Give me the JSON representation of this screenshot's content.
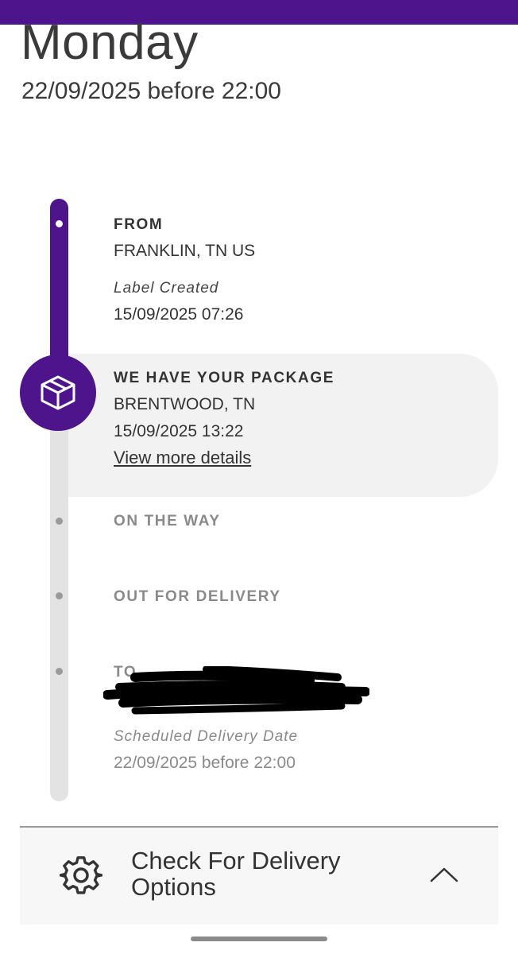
{
  "header": {
    "day": "Monday",
    "eta": "22/09/2025 before 22:00"
  },
  "timeline": {
    "from": {
      "heading": "FROM",
      "location": "FRANKLIN, TN US",
      "status": "Label Created",
      "timestamp": "15/09/2025 07:26"
    },
    "current": {
      "heading": "WE HAVE YOUR PACKAGE",
      "location": "BRENTWOOD, TN",
      "timestamp": "15/09/2025 13:22",
      "details_link": "View more details",
      "icon": "package-box-icon"
    },
    "on_the_way": {
      "heading": "ON THE WAY"
    },
    "out_for_delivery": {
      "heading": "OUT FOR DELIVERY"
    },
    "to": {
      "heading": "TO",
      "status": "Scheduled Delivery Date",
      "timestamp": "22/09/2025 before 22:00"
    }
  },
  "delivery_options": {
    "label": "Check For Delivery Options",
    "icon": "gear-icon",
    "toggle_icon": "chevron-up-icon"
  },
  "colors": {
    "brand_purple": "#4d148c",
    "rail_grey": "#e3e3e3",
    "card_bg": "#f2f2f2"
  }
}
